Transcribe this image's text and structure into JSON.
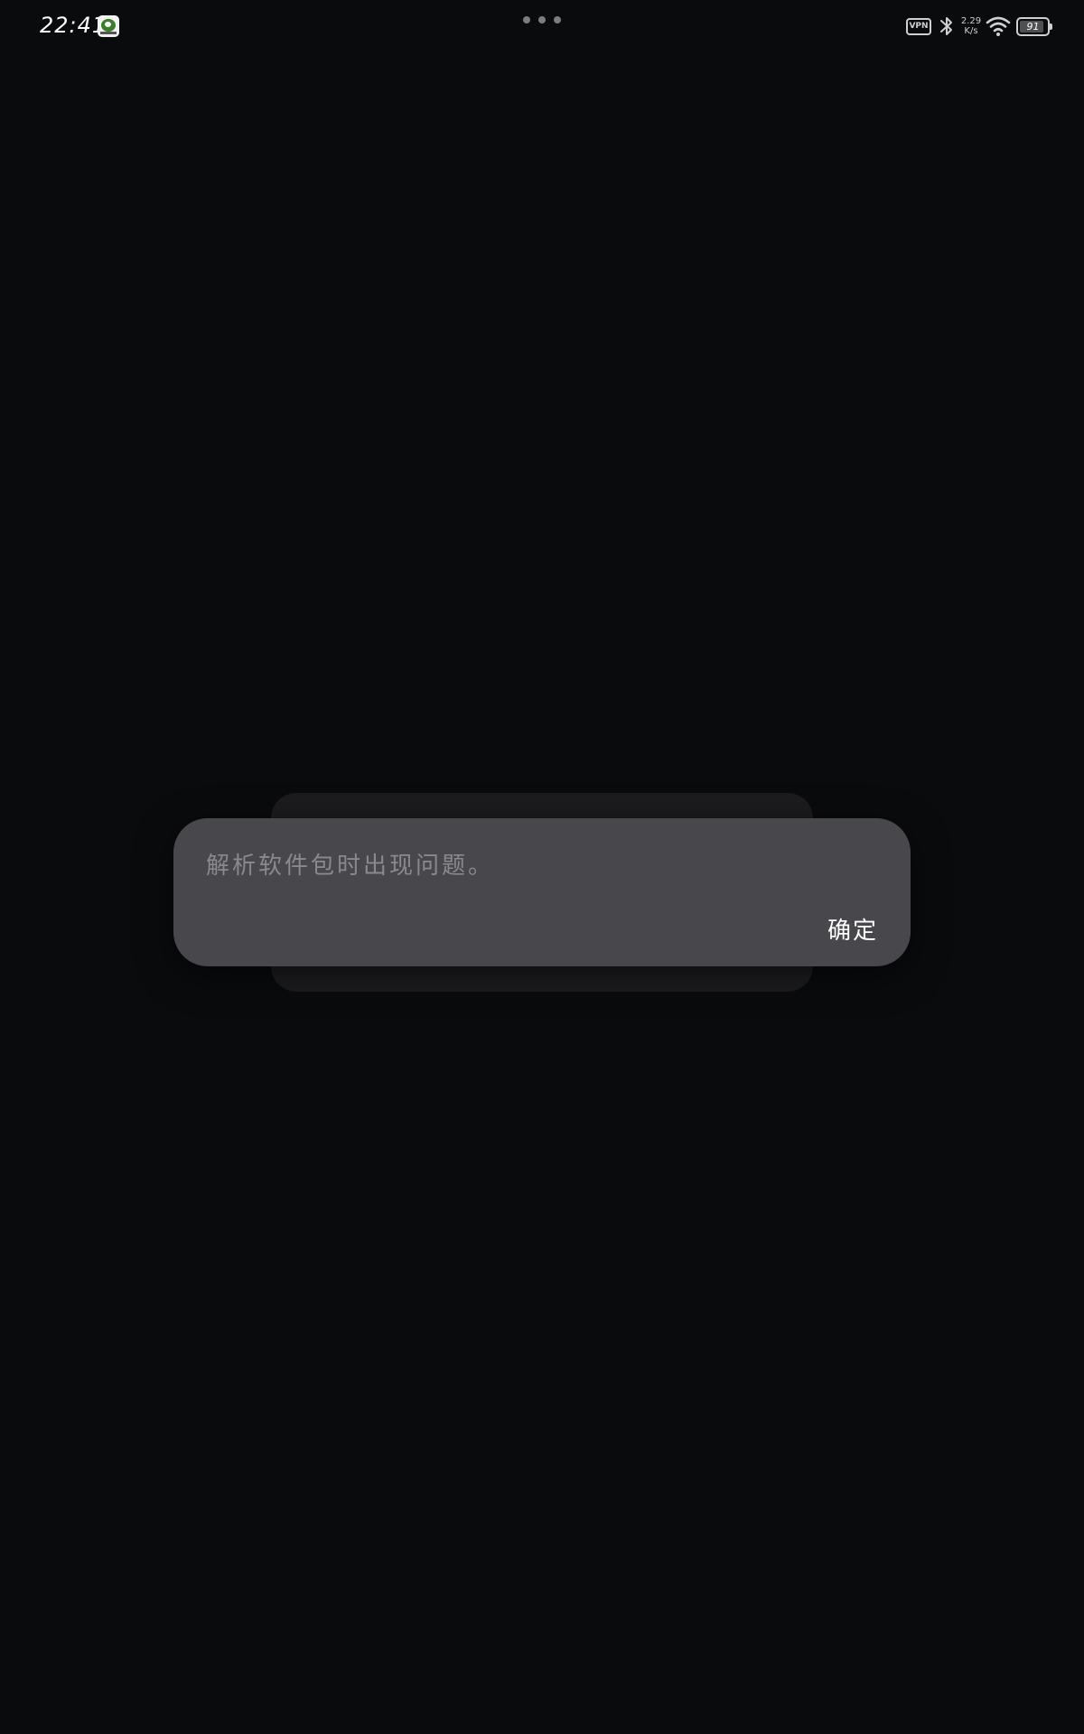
{
  "status_bar": {
    "time": "22:41",
    "app_icon": "app-notification-icon",
    "vpn_label": "VPN",
    "bluetooth_icon": "bluetooth-icon",
    "net_speed_value": "2.29",
    "net_speed_unit": "K/s",
    "wifi_icon": "wifi-icon",
    "battery_level": "91",
    "battery_fraction": 0.91
  },
  "dialog": {
    "message": "解析软件包时出现问题。",
    "confirm_label": "确定"
  },
  "colors": {
    "background": "#0a0b0d",
    "dialog_bg": "#48474c",
    "message_text": "#8a898e",
    "button_text": "#ffffff"
  }
}
